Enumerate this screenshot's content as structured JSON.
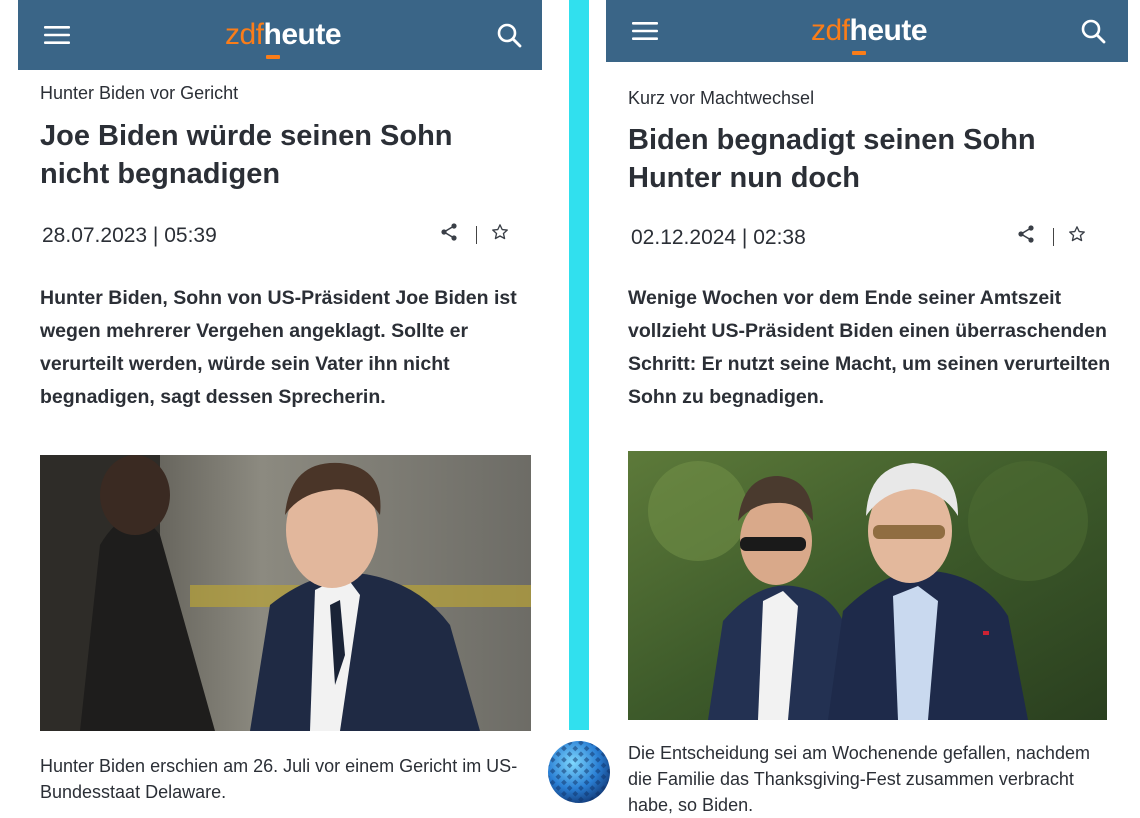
{
  "left": {
    "brand": {
      "zdf": "zdf",
      "heute": "heute"
    },
    "kicker": "Hunter Biden vor Gericht",
    "headline": "Joe Biden würde seinen Sohn nicht begnadigen",
    "date": "28.07.2023 | 05:39",
    "lead": "Hunter Biden, Sohn von US-Präsident Joe Biden ist wegen mehrerer Vergehen angeklagt. Sollte er verurteilt werden, würde sein Vater ihn nicht begnadigen, sagt dessen Sprecherin.",
    "caption": "Hunter Biden erschien am 26. Juli vor einem Gericht im US-Bundesstaat Delaware."
  },
  "right": {
    "brand": {
      "zdf": "zdf",
      "heute": "heute"
    },
    "kicker": "Kurz vor Machtwechsel",
    "headline": "Biden begnadigt seinen Sohn Hunter nun doch",
    "date": "02.12.2024 | 02:38",
    "lead": "Wenige Wochen vor dem Ende seiner Amtszeit vollzieht US-Präsident Biden einen überraschenden Schritt: Er nutzt seine Macht, um seinen verurteilten Sohn zu begnadigen.",
    "caption": "Die Entscheidung sei am Wochenende gefallen, nachdem die Familie das Thanksgiving-Fest zusammen verbracht habe, so Biden."
  },
  "icons": {
    "menu": "menu-icon",
    "search": "search-icon",
    "share": "share-icon",
    "bookmark": "star-icon"
  },
  "colors": {
    "header_bg": "#3a6587",
    "brand_orange": "#fa7d19",
    "divider": "#31e0ee",
    "text": "#2b2f36"
  }
}
